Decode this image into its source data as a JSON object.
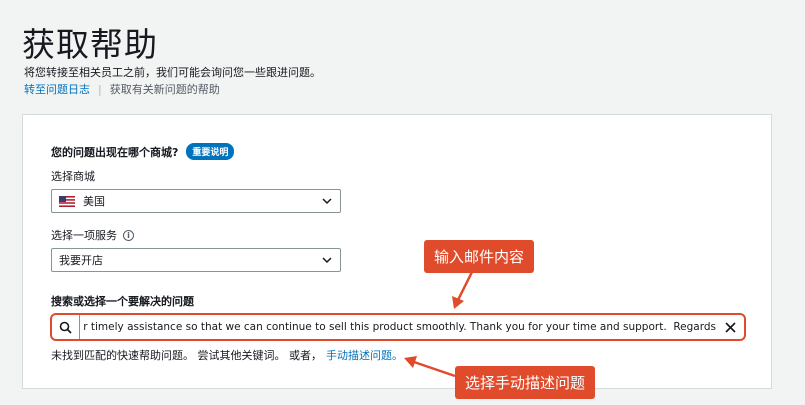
{
  "header": {
    "title": "获取帮助",
    "subtitle": "将您转接至相关员工之前，我们可能会询问您一些跟进问题。",
    "link_case_log": "转至问题日志",
    "link_new_help": "获取有关新问题的帮助"
  },
  "form": {
    "marketplace_question": "您的问题出现在哪个商城?",
    "badge": "重要说明",
    "marketplace_label": "选择商城",
    "marketplace_value": "美国",
    "service_label": "选择一项服务",
    "service_value": "我要开店",
    "search_label": "搜索或选择一个要解决的问题",
    "search_value": "your timely assistance so that we can continue to sell this product smoothly. Thank you for your time and support.  Regards,",
    "not_found_text": "未找到匹配的快速帮助问题。 尝试其他关键词。 或者，",
    "manual_link": "手动描述问题。"
  },
  "annotations": {
    "callout_email": "输入邮件内容",
    "callout_manual": "选择手动描述问题"
  },
  "colors": {
    "accent": "#0073bb",
    "annotation": "#e04b2c"
  }
}
